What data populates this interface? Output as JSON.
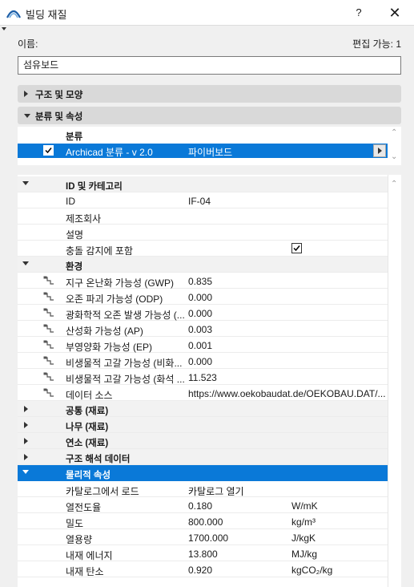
{
  "window": {
    "title": "빌딩 재질",
    "help": "?",
    "close": "✕"
  },
  "header": {
    "name_label": "이름:",
    "edit_label": "편집 가능: 1",
    "name_value": "섬유보드"
  },
  "sections": {
    "structure": "구조 및 모양",
    "classification": "분류 및 속성"
  },
  "classification": {
    "header": "분류",
    "row": {
      "name": "Archicad 분류 - v 2.0",
      "value": "파이버보드"
    }
  },
  "properties": {
    "id_group": "ID 및 카테고리",
    "id_rows": [
      {
        "name": "ID",
        "value": "IF-04"
      },
      {
        "name": "제조회사",
        "value": ""
      },
      {
        "name": "설명",
        "value": ""
      },
      {
        "name": "충돌 감지에 포함",
        "value": ""
      }
    ],
    "env_group": "환경",
    "env_rows": [
      {
        "name": "지구 온난화 가능성 (GWP)",
        "value": "0.835"
      },
      {
        "name": "오존 파괴 가능성 (ODP)",
        "value": "0.000"
      },
      {
        "name": "광화학적 오존 발생 가능성 (...",
        "value": "0.000"
      },
      {
        "name": "산성화 가능성 (AP)",
        "value": "0.003"
      },
      {
        "name": "부영양화 가능성 (EP)",
        "value": "0.001"
      },
      {
        "name": "비생물적 고갈 가능성 (비화...",
        "value": "0.000"
      },
      {
        "name": "비생물적 고갈 가능성 (화석 ...",
        "value": "11.523"
      },
      {
        "name": "데이터 소스",
        "value": "https://www.oekobaudat.de/OEKOBAU.DAT/..."
      }
    ],
    "collapsed_groups": [
      "공통 (재료)",
      "나무 (재료)",
      "연소 (재료)",
      "구조 해석 데이터"
    ],
    "phys_group": "물리적 속성",
    "phys_rows": [
      {
        "name": "카탈로그에서 로드",
        "value": "카탈로그 열기",
        "unit": ""
      },
      {
        "name": "열전도율",
        "value": "0.180",
        "unit": "W/mK"
      },
      {
        "name": "밀도",
        "value": "800.000",
        "unit": "kg/m³"
      },
      {
        "name": "열용량",
        "value": "1700.000",
        "unit": "J/kgK"
      },
      {
        "name": "내재 에너지",
        "value": "13.800",
        "unit": "MJ/kg"
      },
      {
        "name": "내재 탄소",
        "value": "0.920",
        "unit": "kgCO₂/kg"
      }
    ]
  },
  "colors": {
    "selection": "#0a79d8",
    "section_bar": "#d9d9d9"
  },
  "icons": {
    "app": "archicad-logo-icon",
    "link": "link-icon",
    "check": "checkmark-icon"
  }
}
